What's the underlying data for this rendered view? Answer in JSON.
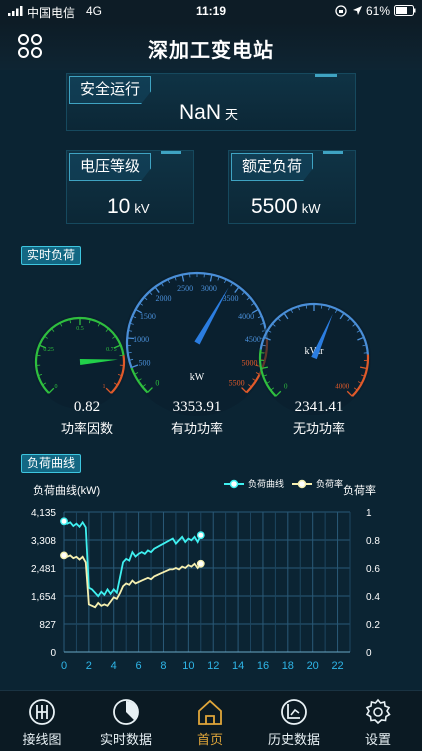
{
  "status_bar": {
    "carrier": "中国电信",
    "network": "4G",
    "time": "11:19",
    "battery": "61%"
  },
  "header": {
    "title": "深加工变电站",
    "menu_icon": "grid-menu-icon"
  },
  "safety": {
    "label": "安全运行",
    "value": "NaN",
    "unit": "天"
  },
  "voltage": {
    "label": "电压等级",
    "value": "10",
    "unit": "kV"
  },
  "rated_load": {
    "label": "额定负荷",
    "value": "5500",
    "unit": "kW"
  },
  "realtime": {
    "section_label": "实时负荷",
    "power_factor": {
      "value": "0.82",
      "label": "功率因数",
      "gauge_value": 0.82,
      "ticks": [
        "0",
        "0.25",
        "0.5",
        "0.75",
        "1"
      ]
    },
    "active_power": {
      "value": "3353.91",
      "label": "有功功率",
      "unit": "kW",
      "gauge_value": 3353.91,
      "max": 5500,
      "ticks": [
        "0",
        "500",
        "1000",
        "1500",
        "2000",
        "2500",
        "3000",
        "3500",
        "4000",
        "4500",
        "5000",
        "5500"
      ]
    },
    "reactive_power": {
      "value": "2341.41",
      "label": "无功功率",
      "unit": "kVar",
      "gauge_value": 2341.41,
      "max": 4000,
      "ticks": [
        "0",
        "4000"
      ]
    }
  },
  "load_curve": {
    "section_label": "负荷曲线"
  },
  "chart_data": {
    "type": "line",
    "ylabel_left": "负荷曲线(kW)",
    "ylabel_right": "负荷率",
    "y_ticks_left": [
      "0",
      "827",
      "1,654",
      "2,481",
      "3,308",
      "4,135"
    ],
    "y_ticks_right": [
      "0",
      "0.2",
      "0.4",
      "0.6",
      "0.8",
      "1"
    ],
    "x_ticks": [
      "0",
      "2",
      "4",
      "6",
      "8",
      "10",
      "12",
      "14",
      "16",
      "18",
      "20",
      "22"
    ],
    "xlim": [
      0,
      23
    ],
    "ylim_left": [
      0,
      4135
    ],
    "ylim_right": [
      0,
      1
    ],
    "series": [
      {
        "name": "负荷曲线",
        "axis": "left",
        "color": "#3ff0f0",
        "x": [
          0,
          0.25,
          0.5,
          0.75,
          1,
          1.25,
          1.5,
          1.75,
          2,
          2.25,
          2.5,
          2.75,
          3,
          3.25,
          3.5,
          3.75,
          4,
          4.25,
          4.5,
          4.75,
          5,
          5.25,
          5.5,
          5.75,
          6,
          6.25,
          6.5,
          6.75,
          7,
          7.25,
          7.5,
          7.75,
          8,
          8.25,
          8.5,
          8.75,
          9,
          9.25,
          9.5,
          9.75,
          10,
          10.25,
          10.5,
          10.75,
          11
        ],
        "values": [
          3860,
          3790,
          3830,
          3720,
          3790,
          3700,
          3830,
          3680,
          1900,
          1850,
          1750,
          1650,
          1780,
          1690,
          1850,
          1720,
          1850,
          1750,
          2200,
          2650,
          2750,
          2700,
          2950,
          2820,
          2900,
          2950,
          2900,
          3000,
          2950,
          3050,
          3100,
          3150,
          3200,
          3250,
          3300,
          3350,
          3200,
          3300,
          3400,
          3250,
          3350,
          3300,
          3400,
          3250,
          3450
        ]
      },
      {
        "name": "负荷率",
        "axis": "right",
        "color": "#f5efb0",
        "x": [
          0,
          0.25,
          0.5,
          0.75,
          1,
          1.25,
          1.5,
          1.75,
          2,
          2.25,
          2.5,
          2.75,
          3,
          3.25,
          3.5,
          3.75,
          4,
          4.25,
          4.5,
          4.75,
          5,
          5.25,
          5.5,
          5.75,
          6,
          6.25,
          6.5,
          6.75,
          7,
          7.25,
          7.5,
          7.75,
          8,
          8.25,
          8.5,
          8.75,
          9,
          9.25,
          9.5,
          9.75,
          10,
          10.25,
          10.5,
          10.75,
          11
        ],
        "values": [
          0.69,
          0.68,
          0.69,
          0.67,
          0.68,
          0.66,
          0.68,
          0.64,
          0.34,
          0.33,
          0.32,
          0.35,
          0.33,
          0.34,
          0.33,
          0.36,
          0.39,
          0.38,
          0.42,
          0.47,
          0.49,
          0.48,
          0.51,
          0.49,
          0.5,
          0.51,
          0.52,
          0.53,
          0.52,
          0.54,
          0.55,
          0.56,
          0.57,
          0.58,
          0.59,
          0.59,
          0.6,
          0.59,
          0.61,
          0.6,
          0.62,
          0.61,
          0.63,
          0.6,
          0.63
        ]
      }
    ]
  },
  "tabs": [
    {
      "label": "接线图",
      "icon": "wiring-icon",
      "active": false
    },
    {
      "label": "实时数据",
      "icon": "realtime-icon",
      "active": false
    },
    {
      "label": "首页",
      "icon": "home-icon",
      "active": true
    },
    {
      "label": "历史数据",
      "icon": "history-icon",
      "active": false
    },
    {
      "label": "设置",
      "icon": "gear-icon",
      "active": false
    }
  ],
  "colors": {
    "accent": "#3ec6e0",
    "active_tab": "#e0a63a",
    "background": "#0b2433"
  }
}
